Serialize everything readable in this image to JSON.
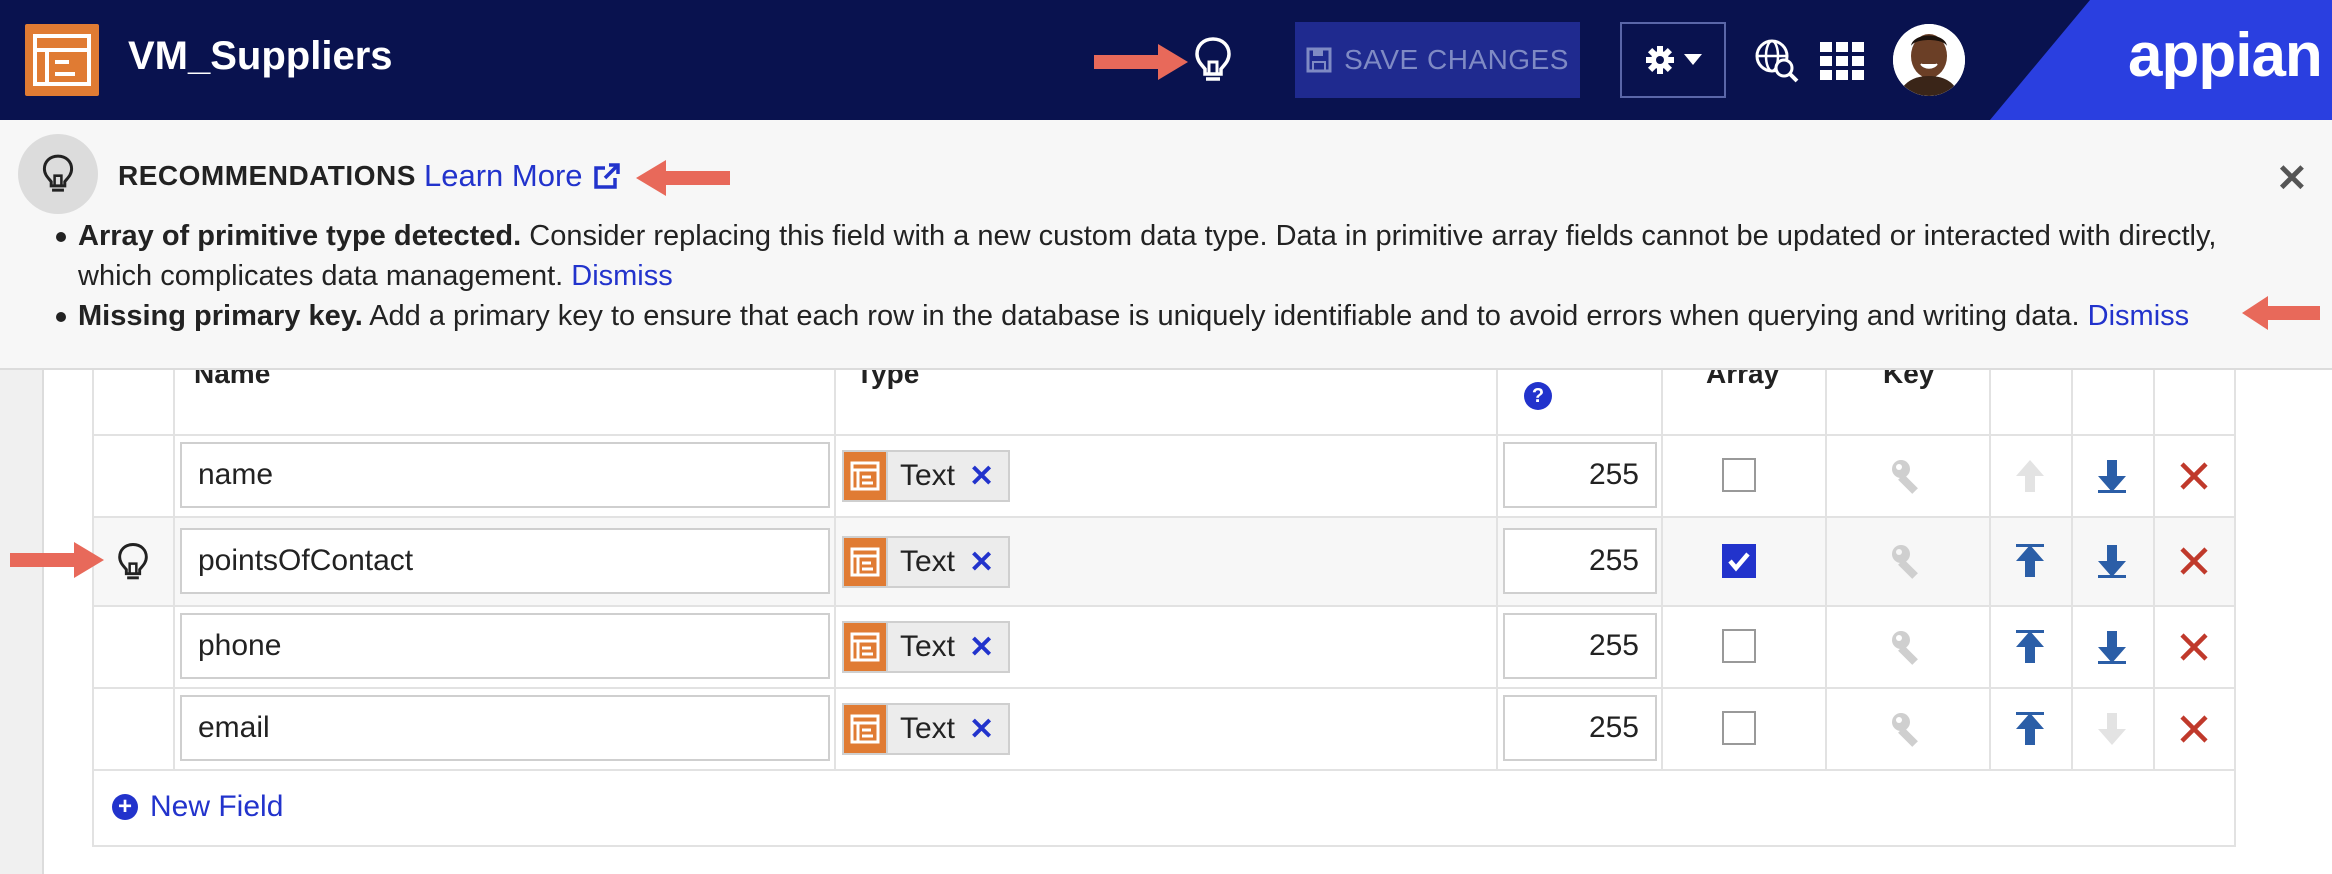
{
  "header": {
    "title": "VM_Suppliers",
    "save_label": "SAVE CHANGES",
    "brand": "appian"
  },
  "banner": {
    "title": "RECOMMENDATIONS",
    "learn_more": "Learn More",
    "items": [
      {
        "title": "Array of primitive type detected.",
        "text": " Consider replacing this field with a new custom data type. Data in primitive array fields cannot be updated or interacted with directly, which complicates data management. ",
        "dismiss": "Dismiss"
      },
      {
        "title": "Missing primary key.",
        "text": " Add a primary key to ensure that each row in the database is uniquely identifiable and to avoid errors when querying and writing data. ",
        "dismiss": "Dismiss"
      }
    ]
  },
  "table": {
    "columns": {
      "name": "Name",
      "type": "Type",
      "array": "Array",
      "key": "Key"
    },
    "rows": [
      {
        "name": "name",
        "type": "Text",
        "length": "255",
        "array": false,
        "recommendation": false
      },
      {
        "name": "pointsOfContact",
        "type": "Text",
        "length": "255",
        "array": true,
        "recommendation": true
      },
      {
        "name": "phone",
        "type": "Text",
        "length": "255",
        "array": false,
        "recommendation": false
      },
      {
        "name": "email",
        "type": "Text",
        "length": "255",
        "array": false,
        "recommendation": false
      }
    ],
    "new_field": "New Field"
  },
  "colors": {
    "header_bg": "#09124f",
    "accent_blue": "#2233cc",
    "orange": "#e07b33",
    "annotation_arrow": "#e8695a",
    "delete_red": "#c0392b"
  }
}
